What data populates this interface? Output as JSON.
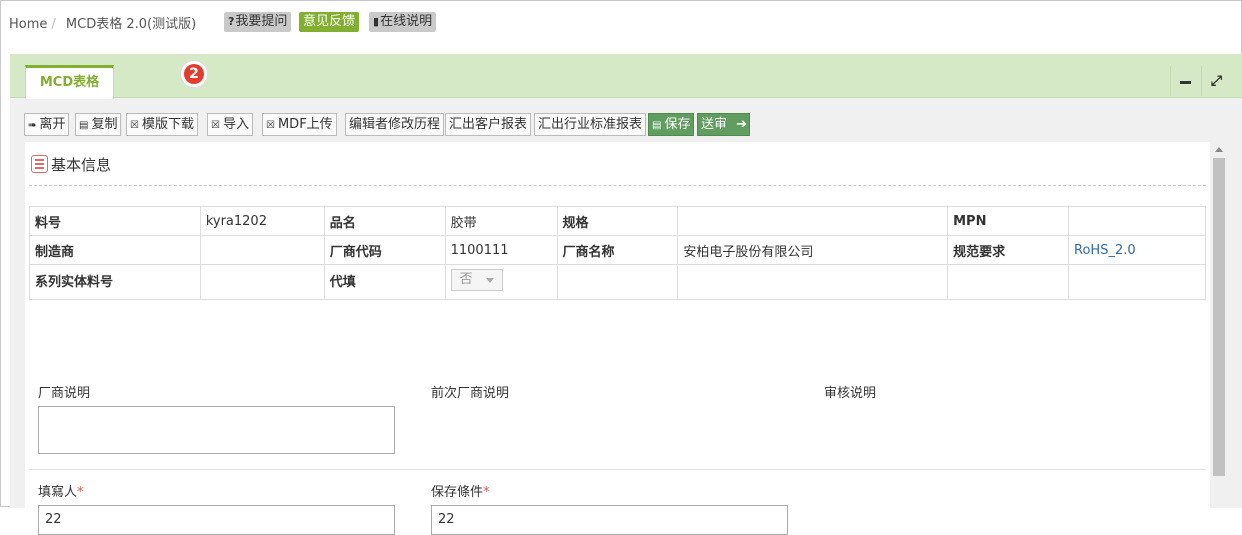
{
  "breadcrumb": {
    "home": "Home",
    "current": "MCD表格 2.0(测试版)"
  },
  "top_links": [
    {
      "icon": "question-icon",
      "label": "我要提问"
    },
    {
      "label": "意见反馈"
    },
    {
      "icon": "book-icon",
      "label": "在线说明"
    }
  ],
  "panel": {
    "tab_label": "MCD表格",
    "badge": "2"
  },
  "toolbar": {
    "leave": "离开",
    "copy": "复制",
    "template_download": "模版下载",
    "import": "导入",
    "mdf_upload": "MDF上传",
    "edit_history": "编辑者修改历程",
    "export_customer": "汇出客户报表",
    "export_industry": "汇出行业标准报表",
    "save": "保存",
    "submit": "送审"
  },
  "section": {
    "title": "基本信息"
  },
  "info": {
    "part_no_label": "料号",
    "part_no": "kyra1202",
    "product_name_label": "品名",
    "product_name": "胶带",
    "spec_label": "规格",
    "spec": "",
    "mpn_label": "MPN",
    "mpn": "",
    "manufacturer_label": "制造商",
    "manufacturer": "",
    "vendor_code_label": "厂商代码",
    "vendor_code": "1100111",
    "vendor_name_label": "厂商名称",
    "vendor_name": "安柏电子股份有限公司",
    "standard_label": "规范要求",
    "standard": "RoHS_2.0",
    "series_label": "系列实体料号",
    "proxy_label": "代填",
    "proxy_value": "否"
  },
  "fields": {
    "vendor_note_label": "厂商说明",
    "prev_vendor_note_label": "前次厂商说明",
    "review_note_label": "审核说明",
    "filler_label": "填寫人",
    "filler_value": "22",
    "storage_label": "保存條件",
    "storage_value": "22",
    "required_mark": "*"
  }
}
